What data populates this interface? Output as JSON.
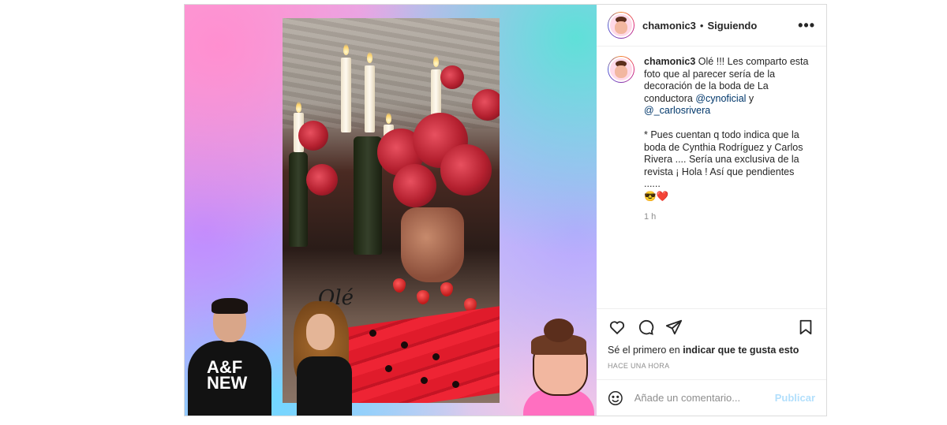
{
  "post": {
    "username": "chamonic3",
    "separator": "•",
    "follow_status": "Siguiendo",
    "more_icon": "more-options-icon",
    "more_label": "•••"
  },
  "media": {
    "overlay_text": "Olé",
    "shirt_text": "A&F NEW"
  },
  "caption": {
    "username": "chamonic3",
    "text_part1": "Olé !!! Les comparto esta foto que al parecer sería de la decoración de la boda de La conductora ",
    "mention1": "@cynoficial",
    "text_part2": " y ",
    "mention2": "@_carlosrivera",
    "text_part3": "\n\n* Pues cuentan q todo indica que la boda de Cynthia Rodríguez y Carlos Rivera .... Sería una exclusiva de la revista ¡ Hola ! Así que pendientes ......\n😎❤️",
    "time": "1 h"
  },
  "actions": {
    "like_icon": "heart-icon",
    "comment_icon": "comment-icon",
    "share_icon": "share-icon",
    "save_icon": "bookmark-icon"
  },
  "likes": {
    "prefix": "Sé el primero en ",
    "bold": "indicar que te gusta esto"
  },
  "timestamp": "HACE UNA HORA",
  "add_comment": {
    "placeholder": "Añade un comentario...",
    "publish_label": "Publicar",
    "emoji_icon": "emoji-icon"
  }
}
